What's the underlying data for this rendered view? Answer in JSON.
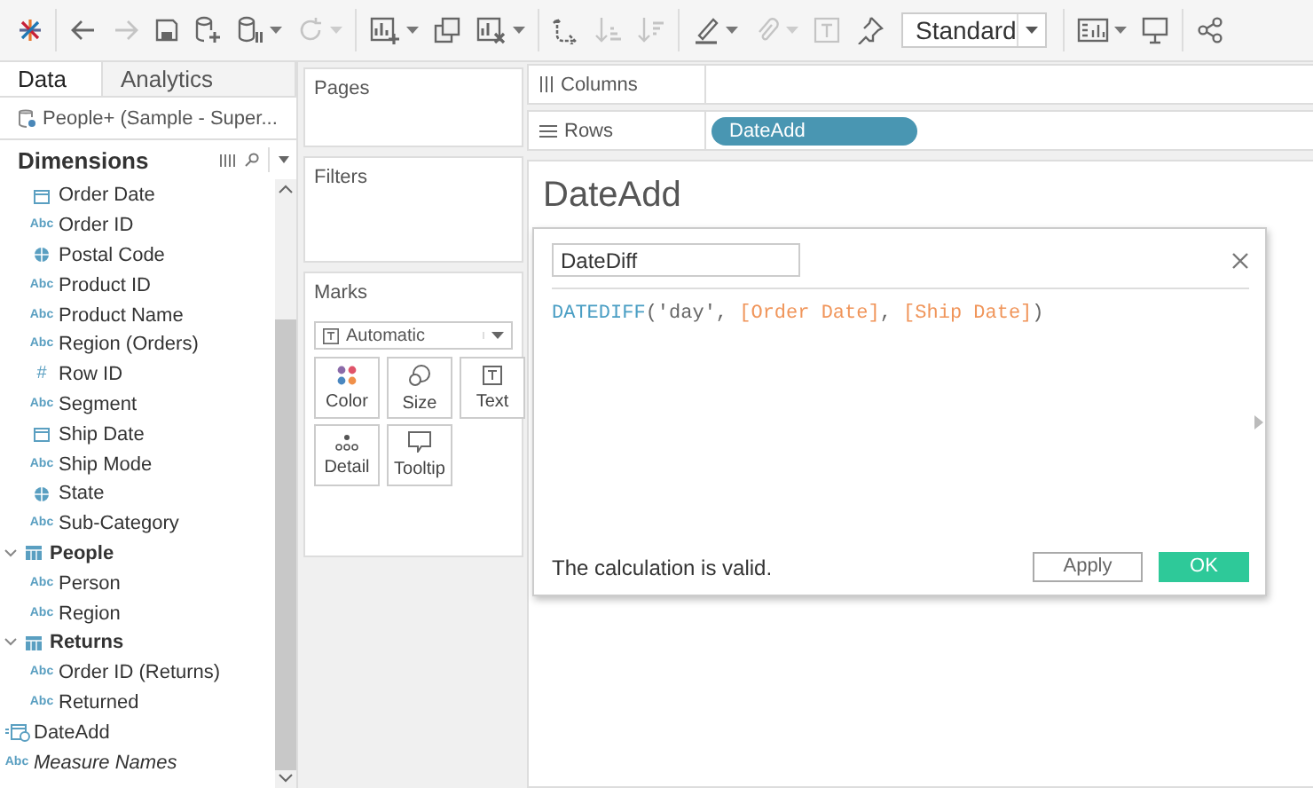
{
  "toolbar": {
    "items": [
      {
        "kind": "logo"
      },
      {
        "kind": "sep"
      },
      {
        "kind": "back",
        "disabled": false
      },
      {
        "kind": "forward",
        "disabled": true
      },
      {
        "kind": "save",
        "disabled": false
      },
      {
        "kind": "new-source",
        "disabled": false
      },
      {
        "kind": "pause",
        "disabled": false,
        "menu": true
      },
      {
        "kind": "refresh",
        "disabled": true,
        "menu": true
      },
      {
        "kind": "sep"
      },
      {
        "kind": "new-sheet",
        "disabled": false,
        "menu": true
      },
      {
        "kind": "duplicate",
        "disabled": false
      },
      {
        "kind": "clear",
        "disabled": false,
        "menu": true
      },
      {
        "kind": "sep"
      },
      {
        "kind": "swap",
        "disabled": false
      },
      {
        "kind": "sort-asc",
        "disabled": true
      },
      {
        "kind": "sort-desc",
        "disabled": true
      },
      {
        "kind": "sep"
      },
      {
        "kind": "highlight",
        "disabled": false,
        "menu": true
      },
      {
        "kind": "clip",
        "disabled": true,
        "menu": true
      },
      {
        "kind": "label",
        "disabled": true
      },
      {
        "kind": "pin",
        "disabled": false
      },
      {
        "kind": "fit",
        "value": "Standard"
      },
      {
        "kind": "sep"
      },
      {
        "kind": "show-cards",
        "disabled": false,
        "menu": true
      },
      {
        "kind": "present",
        "disabled": false
      },
      {
        "kind": "sep"
      },
      {
        "kind": "share",
        "disabled": false
      }
    ]
  },
  "data_pane": {
    "tabs": [
      {
        "label": "Data",
        "selected": true
      },
      {
        "label": "Analytics",
        "selected": false
      }
    ],
    "source": "People+ (Sample - Super...",
    "section": "Dimensions",
    "tree": [
      {
        "kind": "continued",
        "children": [
          {
            "kind": "date",
            "label": "Order Date"
          },
          {
            "kind": "string",
            "icon_text": "Abc",
            "label": "Order ID"
          },
          {
            "kind": "geo",
            "label": "Postal Code"
          },
          {
            "kind": "string",
            "icon_text": "Abc",
            "label": "Product ID"
          },
          {
            "kind": "string",
            "icon_text": "Abc",
            "label": "Product Name"
          },
          {
            "kind": "string",
            "icon_text": "Abc",
            "label": "Region (Orders)"
          },
          {
            "kind": "number",
            "icon_text": "#",
            "label": "Row ID"
          },
          {
            "kind": "string",
            "icon_text": "Abc",
            "label": "Segment"
          },
          {
            "kind": "date",
            "label": "Ship Date"
          },
          {
            "kind": "string",
            "icon_text": "Abc",
            "label": "Ship Mode"
          },
          {
            "kind": "geo",
            "label": "State"
          },
          {
            "kind": "string",
            "icon_text": "Abc",
            "label": "Sub-Category"
          }
        ]
      },
      {
        "kind": "table",
        "label": "People",
        "expanded": true,
        "children": [
          {
            "kind": "string",
            "icon_text": "Abc",
            "label": "Person"
          },
          {
            "kind": "string",
            "icon_text": "Abc",
            "label": "Region"
          }
        ]
      },
      {
        "kind": "table",
        "label": "Returns",
        "expanded": true,
        "children": [
          {
            "kind": "string",
            "icon_text": "Abc",
            "label": "Order ID (Returns)"
          },
          {
            "kind": "string",
            "icon_text": "Abc",
            "label": "Returned"
          }
        ]
      },
      {
        "kind": "calc-date",
        "label": "DateAdd"
      },
      {
        "kind": "string",
        "icon_text": "Abc",
        "label": "Measure Names",
        "italic": true
      }
    ]
  },
  "cards": {
    "pages": "Pages",
    "filters": "Filters",
    "marks": {
      "title": "Marks",
      "mark_type": "Automatic",
      "buttons": [
        {
          "kind": "color",
          "label": "Color"
        },
        {
          "kind": "size",
          "label": "Size"
        },
        {
          "kind": "text",
          "label": "Text"
        },
        {
          "kind": "detail",
          "label": "Detail"
        },
        {
          "kind": "tooltip",
          "label": "Tooltip"
        }
      ]
    }
  },
  "shelves": [
    {
      "kind": "columns",
      "label": "Columns"
    },
    {
      "kind": "rows",
      "label": "Rows",
      "pills": [
        "DateAdd"
      ]
    }
  ],
  "sheet_title": "DateAdd",
  "dialog": {
    "name": "DateDiff",
    "formula": [
      {
        "kind": "function",
        "text": "DATEDIFF"
      },
      {
        "kind": "plain",
        "text": "('day', "
      },
      {
        "kind": "field",
        "text": "[Order Date]"
      },
      {
        "kind": "plain",
        "text": ", "
      },
      {
        "kind": "field",
        "text": "[Ship Date]"
      },
      {
        "kind": "plain",
        "text": ")"
      }
    ],
    "status": "The calculation is valid.",
    "buttons": [
      {
        "label": "Apply",
        "primary": false
      },
      {
        "label": "OK",
        "primary": true
      }
    ]
  }
}
